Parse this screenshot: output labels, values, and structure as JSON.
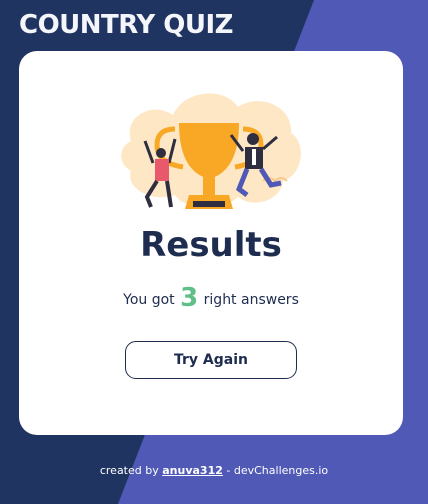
{
  "app": {
    "title": "COUNTRY QUIZ"
  },
  "results": {
    "title": "Results",
    "prefix": "You got",
    "score": "3",
    "suffix": "right answers"
  },
  "actions": {
    "try_again_label": "Try Again"
  },
  "footer": {
    "prefix": "created by",
    "author": "anuva312",
    "separator": "-",
    "site": "devChallenges.io"
  },
  "colors": {
    "background_dark": "#1f3461",
    "background_accent": "#5059b5",
    "text_primary": "#1d2c4f",
    "score_green": "#60bf88",
    "trophy_gold": "#f9a826"
  }
}
